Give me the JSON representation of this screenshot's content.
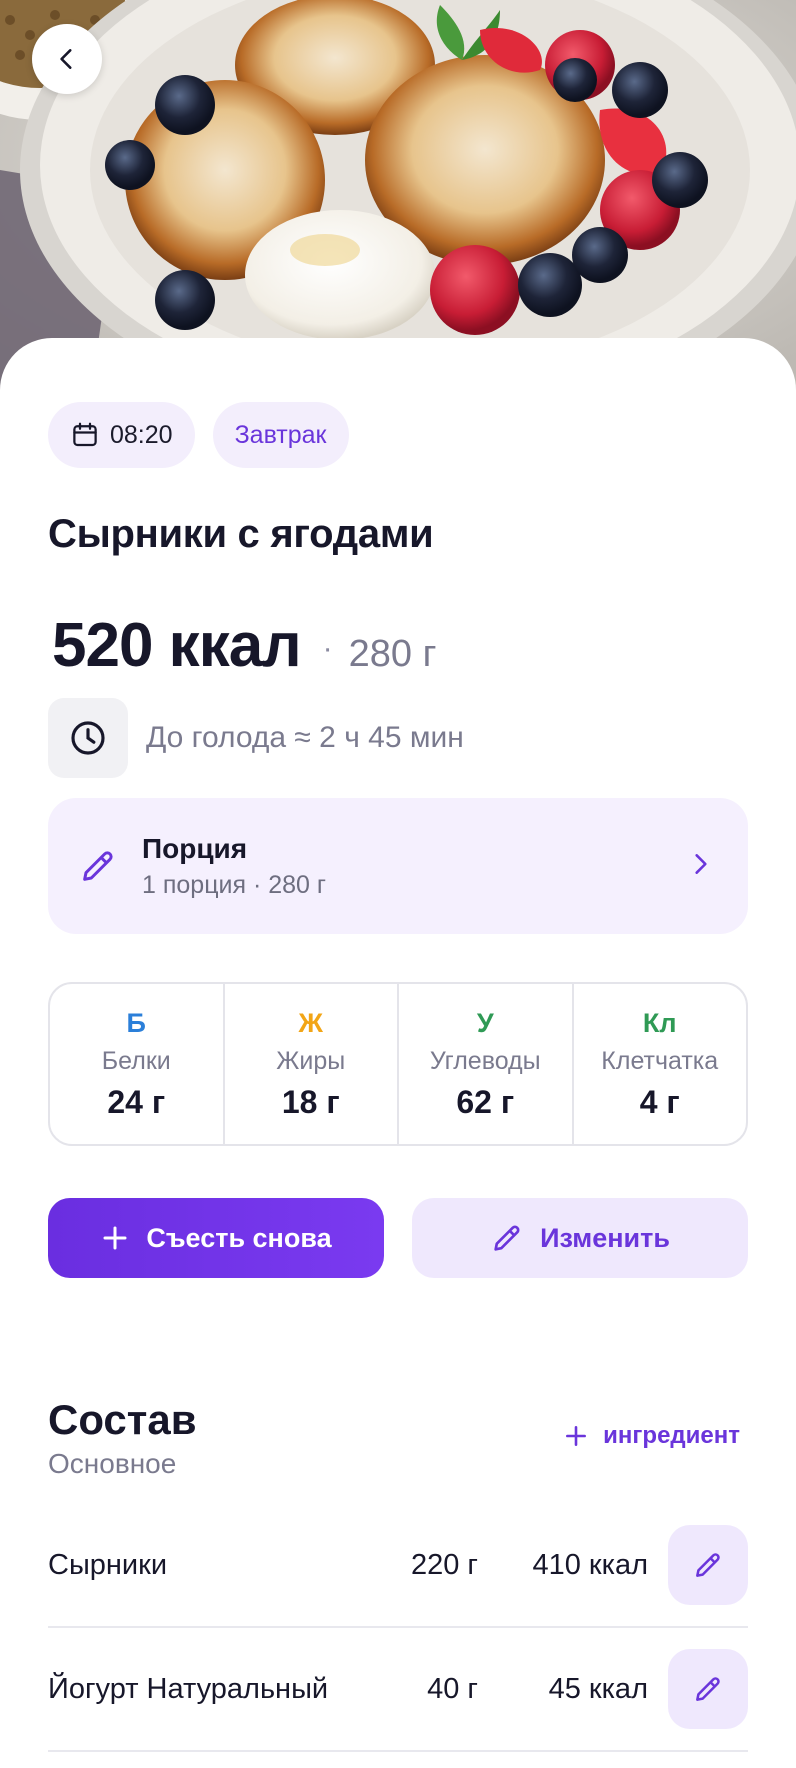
{
  "meta": {
    "time": "08:20",
    "meal": "Завтрак"
  },
  "dish": {
    "title": "Сырники с ягодами",
    "kcal": "520 ккал",
    "separator": "·",
    "weight": "280 г"
  },
  "hunger": {
    "text": "До голода ≈ 2 ч 45 мин"
  },
  "portion": {
    "title": "Порция",
    "subtitle": "1 порция · 280 г"
  },
  "macros": [
    {
      "letter": "Б",
      "name": "Белки",
      "value": "24 г",
      "color": "#2b7fd9"
    },
    {
      "letter": "Ж",
      "name": "Жиры",
      "value": "18 г",
      "color": "#f2a516"
    },
    {
      "letter": "У",
      "name": "Углеводы",
      "value": "62 г",
      "color": "#2f9a55"
    },
    {
      "letter": "Кл",
      "name": "Клетчатка",
      "value": "4 г",
      "color": "#2f9a55"
    }
  ],
  "actions": {
    "eat_again": "Съесть снова",
    "edit": "Изменить"
  },
  "composition": {
    "title": "Состав",
    "subtitle": "Основное",
    "add_label": "ингредиент",
    "items": [
      {
        "name": "Сырники",
        "weight": "220 г",
        "kcal": "410 ккал"
      },
      {
        "name": "Йогурт Натуральный",
        "weight": "40 г",
        "kcal": "45 ккал"
      }
    ]
  },
  "colors": {
    "accent": "#6a35db",
    "accent_light": "#efe8fd"
  },
  "icons": {
    "back": "chevron-left-icon",
    "calendar": "calendar-icon",
    "clock": "clock-icon",
    "pencil": "pencil-icon",
    "chevron": "chevron-right-icon",
    "plus": "plus-icon"
  }
}
